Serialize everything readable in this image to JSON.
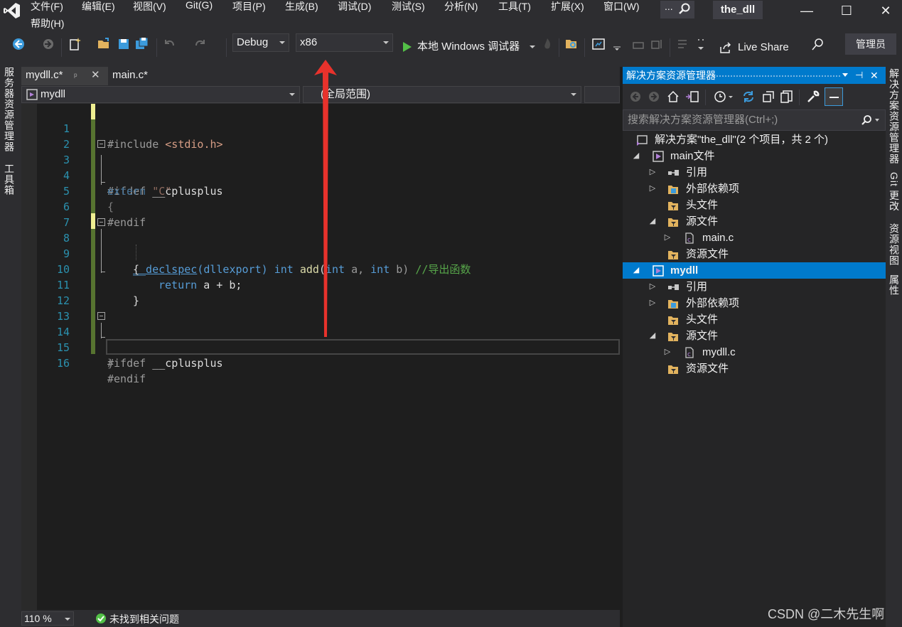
{
  "menu": {
    "items": [
      "文件(F)",
      "编辑(E)",
      "视图(V)",
      "Git(G)",
      "项目(P)",
      "生成(B)",
      "调试(D)",
      "测试(S)",
      "分析(N)",
      "工具(T)",
      "扩展(X)",
      "窗口(W)"
    ],
    "help": "帮助(H)",
    "search_label": "...",
    "solution_name": "the_dll",
    "minimize": "—",
    "maximize": "☐",
    "close": "✕"
  },
  "toolbar": {
    "configuration": "Debug",
    "platform": "x86",
    "run_label": "本地 Windows 调试器",
    "live_share": "Live Share",
    "admin": "管理员"
  },
  "left_tabs": [
    "服务器资源管理器",
    "工具箱"
  ],
  "right_tabs": [
    "解决方案资源管理器",
    "Git 更改",
    "资源视图",
    "属性"
  ],
  "editor_tabs": [
    {
      "label": "mydll.c*",
      "pin": "ᵖ",
      "close": "✕"
    },
    {
      "label": "main.c*"
    }
  ],
  "navbar": {
    "project": "mydll",
    "scope": "(全局范围)"
  },
  "code": {
    "line_numbers": [
      "1",
      "2",
      "3",
      "4",
      "5",
      "6",
      "7",
      "8",
      "9",
      "10",
      "11",
      "12",
      "13",
      "14",
      "15",
      "16"
    ],
    "tokens": {
      "l1_pp": "#include",
      "l1_hdr": "<stdio.h>",
      "l3_pp": "#ifdef",
      "l3_mac": "__cplusplus",
      "l4_kw": "extern",
      "l4_str": "\"C\"",
      "l5": "{",
      "l6_pp": "#endif",
      "l8_kw": "__declspec",
      "l8_attr": "(dllexport)",
      "l8_type": "int",
      "l8_fn": "add",
      "l8_open": "(",
      "l8_type2": "int",
      "l8_a": "a,",
      "l8_type3": "int",
      "l8_b": "b)",
      "l8_cmt": "//导出函数",
      "l9": "{",
      "l10_kw": "return",
      "l10_rest": "a + b;",
      "l11": "}",
      "l14_pp": "#ifdef",
      "l14_mac": "__cplusplus",
      "l15": "}",
      "l16_pp": "#endif"
    }
  },
  "editor_status": {
    "zoom": "110 %",
    "issues": "未找到相关问题"
  },
  "solution_explorer": {
    "header": "解决方案资源管理器",
    "search_placeholder": "搜索解决方案资源管理器(Ctrl+;)",
    "tree": [
      {
        "label": "解决方案\"the_dll\"(2 个项目，共 2 个)",
        "icon": "solution-icon"
      },
      {
        "label": "main文件",
        "icon": "project-icon"
      },
      {
        "label": "引用",
        "icon": "references-icon"
      },
      {
        "label": "外部依赖项",
        "icon": "external-deps-icon"
      },
      {
        "label": "头文件",
        "icon": "filter-folder-icon"
      },
      {
        "label": "源文件",
        "icon": "filter-folder-icon"
      },
      {
        "label": "main.c",
        "icon": "c-file-icon"
      },
      {
        "label": "资源文件",
        "icon": "filter-folder-icon"
      },
      {
        "label": "mydll",
        "icon": "project-icon"
      },
      {
        "label": "引用",
        "icon": "references-icon"
      },
      {
        "label": "外部依赖项",
        "icon": "external-deps-icon"
      },
      {
        "label": "头文件",
        "icon": "filter-folder-icon"
      },
      {
        "label": "源文件",
        "icon": "filter-folder-icon"
      },
      {
        "label": "mydll.c",
        "icon": "c-file-icon"
      },
      {
        "label": "资源文件",
        "icon": "filter-folder-icon"
      }
    ]
  },
  "watermark": "CSDN @二木先生啊",
  "colors": {
    "accent": "#007acc",
    "background": "#1e1e1e",
    "chrome": "#2d2d30",
    "arrow": "#e8322c",
    "run_green": "#53c047"
  }
}
